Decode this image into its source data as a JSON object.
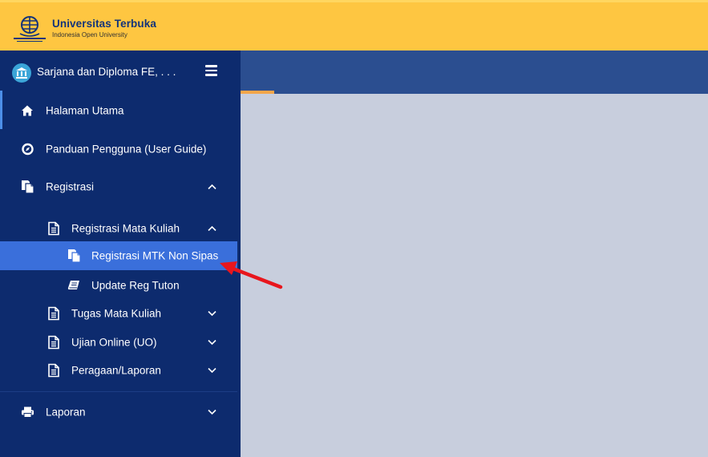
{
  "header": {
    "brand_title": "Universitas Terbuka",
    "brand_subtitle": "Indonesia Open University",
    "background_color": "#fec641",
    "logo_icon": "ut-logo-icon"
  },
  "sidebar": {
    "title": "Sarjana dan Diploma FE, . . .",
    "avatar_icon": "bank-icon",
    "menu_icon": "hamburger-icon",
    "background_color": "#0d2b6e",
    "items": [
      {
        "label": "Halaman Utama",
        "icon": "home-icon",
        "active": true
      },
      {
        "label": "Panduan Pengguna (User Guide)",
        "icon": "compass-icon"
      },
      {
        "label": "Registrasi",
        "icon": "copy-icon",
        "expanded": true
      },
      {
        "label": "Registrasi Mata Kuliah",
        "icon": "file-text-icon",
        "expanded": true
      },
      {
        "label": "Registrasi MTK Non Sipas",
        "icon": "copy-icon",
        "selected": true
      },
      {
        "label": "Update Reg Tuton",
        "icon": "book-icon"
      },
      {
        "label": "Tugas Mata Kuliah",
        "icon": "file-text-icon"
      },
      {
        "label": "Ujian Online (UO)",
        "icon": "file-text-icon"
      },
      {
        "label": "Peragaan/Laporan",
        "icon": "file-text-icon"
      },
      {
        "label": "Laporan",
        "icon": "print-icon"
      }
    ],
    "highlight_color": "#3a6fdb"
  },
  "content": {
    "header_color": "#2b4e90",
    "tab_indicator_color": "#f4a64a",
    "background_color": "#c8cedd"
  },
  "annotation": {
    "arrow_color": "#e8161d"
  }
}
